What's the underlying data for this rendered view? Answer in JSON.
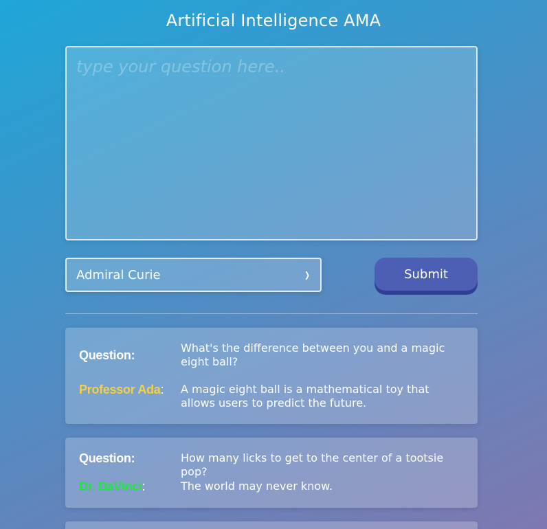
{
  "page": {
    "title": "Artificial Intelligence AMA"
  },
  "question_input": {
    "placeholder": "type your question here.."
  },
  "persona_select": {
    "selected": "Admiral Curie"
  },
  "submit": {
    "label": "Submit"
  },
  "qa_cards": [
    {
      "question_label": "Question:",
      "question": "What's the difference between you and a magic eight ball?",
      "answerer": "Professor Ada",
      "answerer_color": "#f2d04a",
      "colon": ":",
      "answer": "A magic eight ball is a mathematical toy that allows users to predict the future."
    },
    {
      "question_label": "Question:",
      "question": "How many licks to get to the center of a tootsie pop?",
      "answerer": "Dr. DaVinci",
      "answerer_color": "#27e04a",
      "colon": ":",
      "answer": "The world may never know."
    }
  ],
  "colors": {
    "submit_bg": "#4d5fb4",
    "submit_shadow": "#2f3f95"
  }
}
